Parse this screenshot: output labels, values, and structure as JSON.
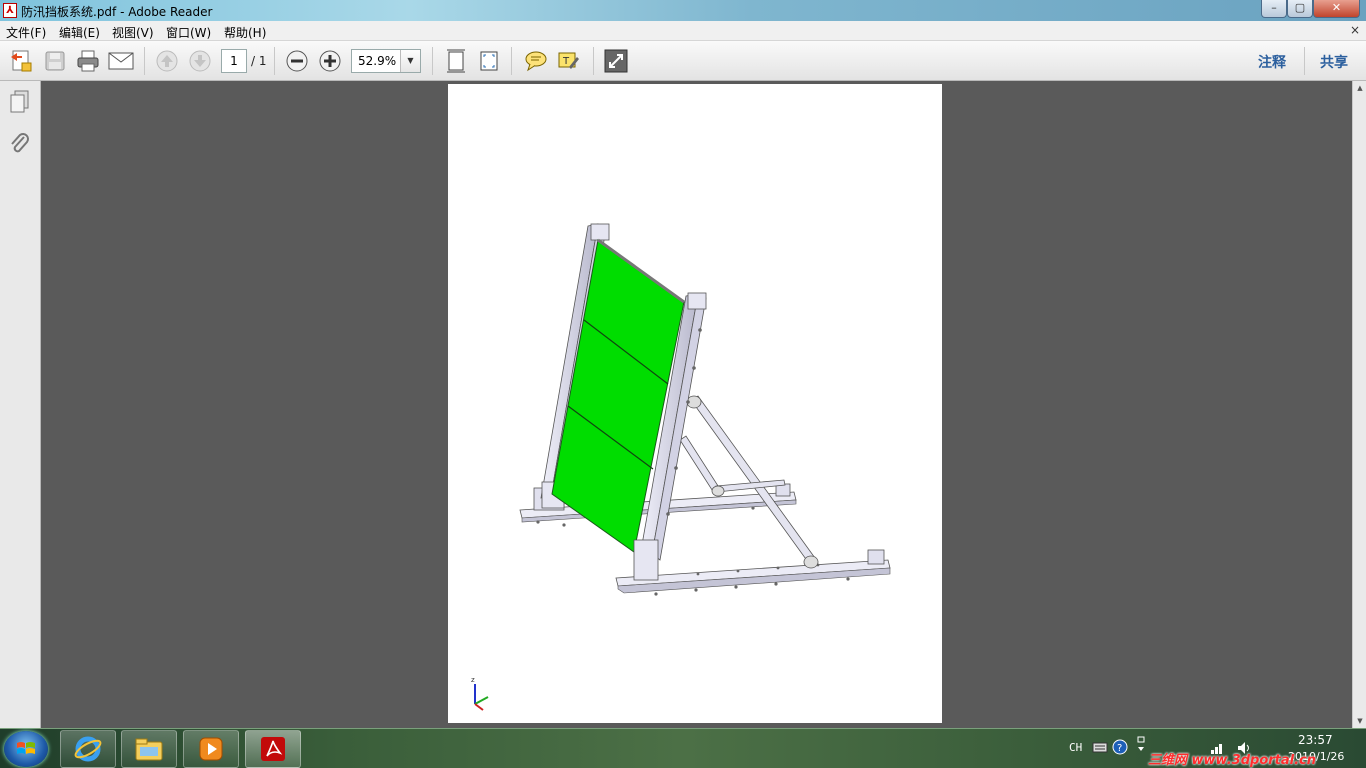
{
  "window": {
    "title": "防汛挡板系统.pdf - Adobe Reader",
    "controls": {
      "minimize": "–",
      "maximize": "▢",
      "close": "✕"
    }
  },
  "menu": {
    "items": [
      "文件(F)",
      "编辑(E)",
      "视图(V)",
      "窗口(W)",
      "帮助(H)"
    ],
    "close_glyph": "×"
  },
  "toolbar": {
    "page_current": "1",
    "page_total": "/ 1",
    "zoom": "52.9%",
    "comment_label": "注释",
    "share_label": "共享",
    "icons": [
      "create-pdf-icon",
      "save-icon",
      "print-icon",
      "email-icon",
      "page-up-icon",
      "page-down-icon",
      "zoom-out-icon",
      "zoom-in-icon",
      "fit-page-icon",
      "fit-width-icon",
      "sticky-note-icon",
      "highlight-icon",
      "read-mode-icon"
    ]
  },
  "leftnav": {
    "icons": [
      "pages-icon",
      "attachment-icon"
    ]
  },
  "document": {
    "axis_label": "z"
  },
  "taskbar": {
    "apps": [
      "ie-icon",
      "explorer-icon",
      "media-player-icon",
      "adobe-reader-icon"
    ],
    "tray": {
      "lang": "CH",
      "time": "23:57",
      "date": "2010/1/26"
    },
    "watermark": "三维网 www.3dportal.cn"
  },
  "colors": {
    "panel_green": "#00dd00",
    "frame_gray": "#d8d8ec",
    "accent_blue": "#2b5f9e"
  }
}
